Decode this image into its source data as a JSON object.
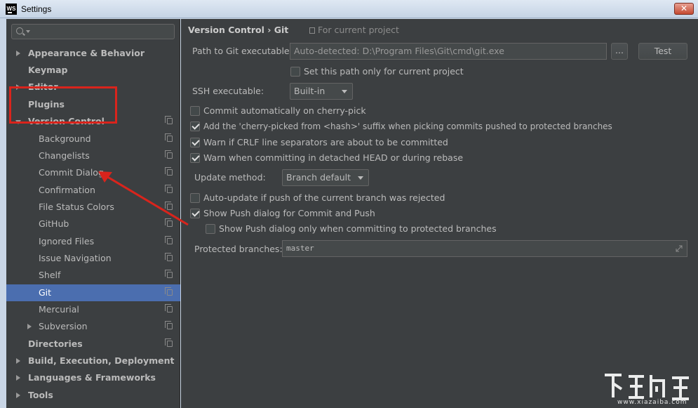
{
  "window": {
    "icon_text": "WS",
    "title": "Settings",
    "close_label": "✕"
  },
  "sidebar": {
    "search_placeholder": "",
    "items": [
      {
        "label": "Appearance & Behavior"
      },
      {
        "label": "Keymap"
      },
      {
        "label": "Editor"
      },
      {
        "label": "Plugins"
      },
      {
        "label": "Version Control"
      },
      {
        "label": "Background"
      },
      {
        "label": "Changelists"
      },
      {
        "label": "Commit Dialog"
      },
      {
        "label": "Confirmation"
      },
      {
        "label": "File Status Colors"
      },
      {
        "label": "GitHub"
      },
      {
        "label": "Ignored Files"
      },
      {
        "label": "Issue Navigation"
      },
      {
        "label": "Shelf"
      },
      {
        "label": "Git"
      },
      {
        "label": "Mercurial"
      },
      {
        "label": "Subversion"
      },
      {
        "label": "Directories"
      },
      {
        "label": "Build, Execution, Deployment"
      },
      {
        "label": "Languages & Frameworks"
      },
      {
        "label": "Tools"
      }
    ],
    "selected": "Git"
  },
  "header": {
    "breadcrumb": "Version Control  ›  Git",
    "hint": "For current project"
  },
  "git": {
    "path_label": "Path to Git executable:",
    "path_value": "Auto-detected: D:\\Program Files\\Git\\cmd\\git.exe",
    "browse_label": "...",
    "test_label": "Test",
    "current_project_only": "Set this path only for current project",
    "ssh_label": "SSH executable:",
    "ssh_value": "Built-in",
    "options": [
      {
        "label": "Commit automatically on cherry-pick",
        "checked": false
      },
      {
        "label": "Add the 'cherry-picked from <hash>' suffix when picking commits pushed to protected branches",
        "checked": true
      },
      {
        "label": "Warn if CRLF line separators are about to be committed",
        "checked": true
      },
      {
        "label": "Warn when committing in detached HEAD or during rebase",
        "checked": true
      }
    ],
    "update_method_label": "Update method:",
    "update_method_value": "Branch default",
    "push_options": [
      {
        "label": "Auto-update if push of the current branch was rejected",
        "checked": false
      },
      {
        "label": "Show Push dialog for Commit and Push",
        "checked": true
      },
      {
        "label": "Show Push dialog only when committing to protected branches",
        "checked": false
      }
    ],
    "protected_label": "Protected branches:",
    "protected_value": "master"
  },
  "watermark": {
    "text": "www.xiazaiba.com"
  },
  "colors": {
    "panel_bg": "#3c3f41",
    "selection": "#4b6eaf",
    "annotation": "#d9241c"
  }
}
